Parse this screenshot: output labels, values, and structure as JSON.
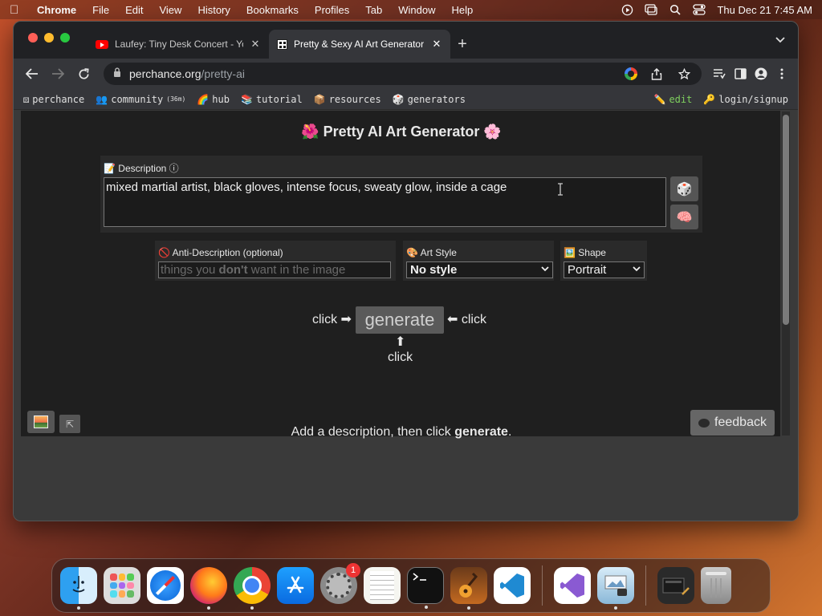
{
  "menubar": {
    "app_name": "Chrome",
    "items": [
      "File",
      "Edit",
      "View",
      "History",
      "Bookmarks",
      "Profiles",
      "Tab",
      "Window",
      "Help"
    ],
    "datetime": "Thu Dec 21  7:45 AM"
  },
  "browser": {
    "tabs": [
      {
        "title": "Laufey: Tiny Desk Concert - Yo",
        "close": "✕"
      },
      {
        "title": "Pretty & Sexy AI Art Generator",
        "close": "✕"
      }
    ],
    "new_tab": "+",
    "url_host": "perchance.org",
    "url_path": "/pretty-ai",
    "bookmarks": [
      {
        "icon": "⚄",
        "label": "perchance"
      },
      {
        "icon": "👥",
        "label": "community",
        "extra": "(36m)"
      },
      {
        "icon": "🌈",
        "label": "hub"
      },
      {
        "icon": "📚",
        "label": "tutorial"
      },
      {
        "icon": "📦",
        "label": "resources"
      },
      {
        "icon": "🎲",
        "label": "generators"
      }
    ],
    "bookmarks_right": [
      {
        "icon": "✏️",
        "label": "edit"
      },
      {
        "icon": "🔑",
        "label": "login/signup"
      }
    ]
  },
  "page": {
    "title": "🌺 Pretty AI Art Generator 🌸",
    "description": {
      "label": "📝 Description ⓘ",
      "value": "mixed martial artist, black gloves, intense focus, sweaty glow, inside a cage"
    },
    "dice_icon": "🎲",
    "brain_icon": "🧠",
    "anti_description": {
      "label": "🚫 Anti-Description (optional)",
      "placeholder_pre": "things you ",
      "placeholder_bold": "don't",
      "placeholder_post": " want in the image"
    },
    "art_style": {
      "label": "🎨 Art Style",
      "selected": "No style"
    },
    "shape": {
      "label": "🖼️ Shape",
      "selected": "Portrait"
    },
    "generate": {
      "button": "generate",
      "click_left": "click ➡",
      "click_right": "⬅ click",
      "arrow_up": "⬆",
      "click_below": "click"
    },
    "status_pre": "Add a description, then click ",
    "status_bold": "generate",
    "status_post": ".",
    "feedback": "feedback",
    "collapse_icon": "⇱"
  },
  "dock": {
    "settings_badge": "1"
  }
}
